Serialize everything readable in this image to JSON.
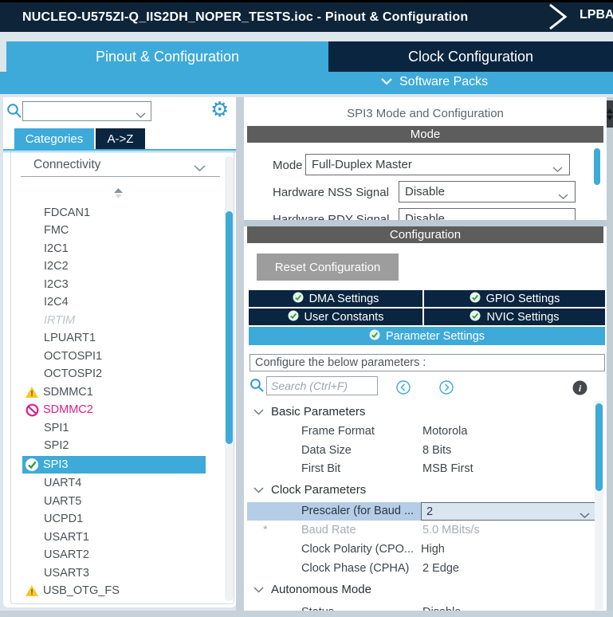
{
  "title_bar": {
    "title": "NUCLEO-U575ZI-Q_IIS2DH_NOPER_TESTS.ioc - Pinout & Configuration",
    "next_breadcrumb": "LPBA"
  },
  "main_tabs": {
    "pinout": "Pinout & Configuration",
    "clock": "Clock Configuration"
  },
  "software_packs_label": "Software Packs",
  "sidebar": {
    "search_value": "",
    "tabs": {
      "categories": "Categories",
      "az": "A->Z"
    },
    "section_label": "Connectivity",
    "items": [
      {
        "label": "FDCAN1",
        "state": "normal"
      },
      {
        "label": "FMC",
        "state": "normal"
      },
      {
        "label": "I2C1",
        "state": "normal"
      },
      {
        "label": "I2C2",
        "state": "normal"
      },
      {
        "label": "I2C3",
        "state": "normal"
      },
      {
        "label": "I2C4",
        "state": "normal"
      },
      {
        "label": "IRTIM",
        "state": "unavailable"
      },
      {
        "label": "LPUART1",
        "state": "normal"
      },
      {
        "label": "OCTOSPI1",
        "state": "normal"
      },
      {
        "label": "OCTOSPI2",
        "state": "normal"
      },
      {
        "label": "SDMMC1",
        "state": "warning"
      },
      {
        "label": "SDMMC2",
        "state": "blocked"
      },
      {
        "label": "SPI1",
        "state": "normal"
      },
      {
        "label": "SPI2",
        "state": "normal"
      },
      {
        "label": "SPI3",
        "state": "selected"
      },
      {
        "label": "UART4",
        "state": "normal"
      },
      {
        "label": "UART5",
        "state": "normal"
      },
      {
        "label": "UCPD1",
        "state": "normal"
      },
      {
        "label": "USART1",
        "state": "normal"
      },
      {
        "label": "USART2",
        "state": "normal"
      },
      {
        "label": "USART3",
        "state": "normal"
      },
      {
        "label": "USB_OTG_FS",
        "state": "warning"
      }
    ]
  },
  "config_panel": {
    "title": "SPI3 Mode and Configuration",
    "mode": {
      "header": "Mode",
      "rows": [
        {
          "label": "Mode",
          "value": "Full-Duplex Master"
        },
        {
          "label": "Hardware NSS Signal",
          "value": "Disable"
        },
        {
          "label": "Hardware RDY Signal",
          "value": "Disable"
        }
      ]
    },
    "configuration": {
      "header": "Configuration",
      "reset_button": "Reset Configuration",
      "tabs": [
        {
          "label": "DMA Settings"
        },
        {
          "label": "GPIO Settings"
        },
        {
          "label": "User Constants"
        },
        {
          "label": "NVIC Settings"
        },
        {
          "label": "Parameter Settings",
          "active": true
        }
      ],
      "hint": "Configure the below parameters :",
      "search_placeholder": "Search (Ctrl+F)",
      "tree": [
        {
          "type": "group",
          "label": "Basic Parameters"
        },
        {
          "type": "row",
          "label": "Frame Format",
          "value": "Motorola"
        },
        {
          "type": "row",
          "label": "Data Size",
          "value": "8 Bits"
        },
        {
          "type": "row",
          "label": "First Bit",
          "value": "MSB First"
        },
        {
          "type": "group",
          "label": "Clock Parameters"
        },
        {
          "type": "editing",
          "label": "Prescaler (for Baud ...",
          "value": "2"
        },
        {
          "type": "disabled",
          "prefix": "*",
          "label": "Baud Rate",
          "value": "5.0 MBits/s"
        },
        {
          "type": "row",
          "label": "Clock Polarity (CPO...",
          "value": "High"
        },
        {
          "type": "row",
          "label": "Clock Phase (CPHA)",
          "value": "2 Edge"
        },
        {
          "type": "group",
          "label": "Autonomous Mode"
        },
        {
          "type": "clipped",
          "label": "Status",
          "value": "Disable"
        }
      ]
    }
  },
  "colors": {
    "accent_blue": "#3daad9",
    "navy": "#0a2540",
    "titlebar_navy": "#0d2439",
    "header_gray": "#5d5d5d",
    "warning_amber": "#f7c52e",
    "blocked_magenta": "#d8218c",
    "ok_green": "#2f9e41",
    "highlight_row": "#b5cde6"
  }
}
